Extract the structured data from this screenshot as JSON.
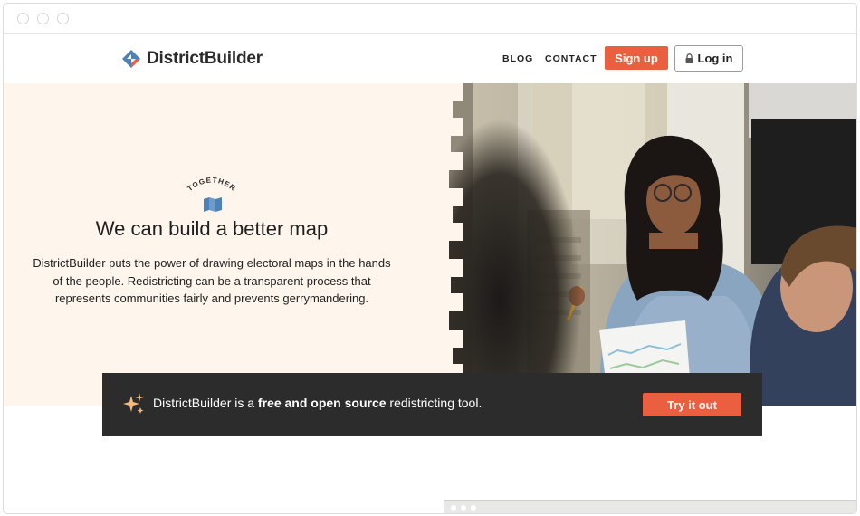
{
  "brand": {
    "name": "DistrictBuilder"
  },
  "nav": {
    "blog": "BLOG",
    "contact": "CONTACT",
    "signup": "Sign up",
    "login": "Log in"
  },
  "hero": {
    "tagline": "TOGETHER",
    "headline": "We can build a better map",
    "intro": "DistrictBuilder puts the power of drawing electoral maps in the hands of the people. Redistricting can be a transparent process that represents communities fairly and prevents gerrymandering."
  },
  "banner": {
    "text_prefix": "DistrictBuilder is a ",
    "text_bold": "free and open source",
    "text_suffix": " redistricting tool.",
    "cta": "Try it out"
  },
  "colors": {
    "accent": "#ea5f3f",
    "hero_bg": "#fef6ec",
    "banner_bg": "#2c2c2c",
    "brand_blue": "#4d82b8",
    "sparkle": "#f5b97a"
  },
  "icons": {
    "logo": "district-builder-logo-icon",
    "lock": "lock-icon",
    "map": "folded-map-icon",
    "sparkle": "sparkle-icon"
  }
}
